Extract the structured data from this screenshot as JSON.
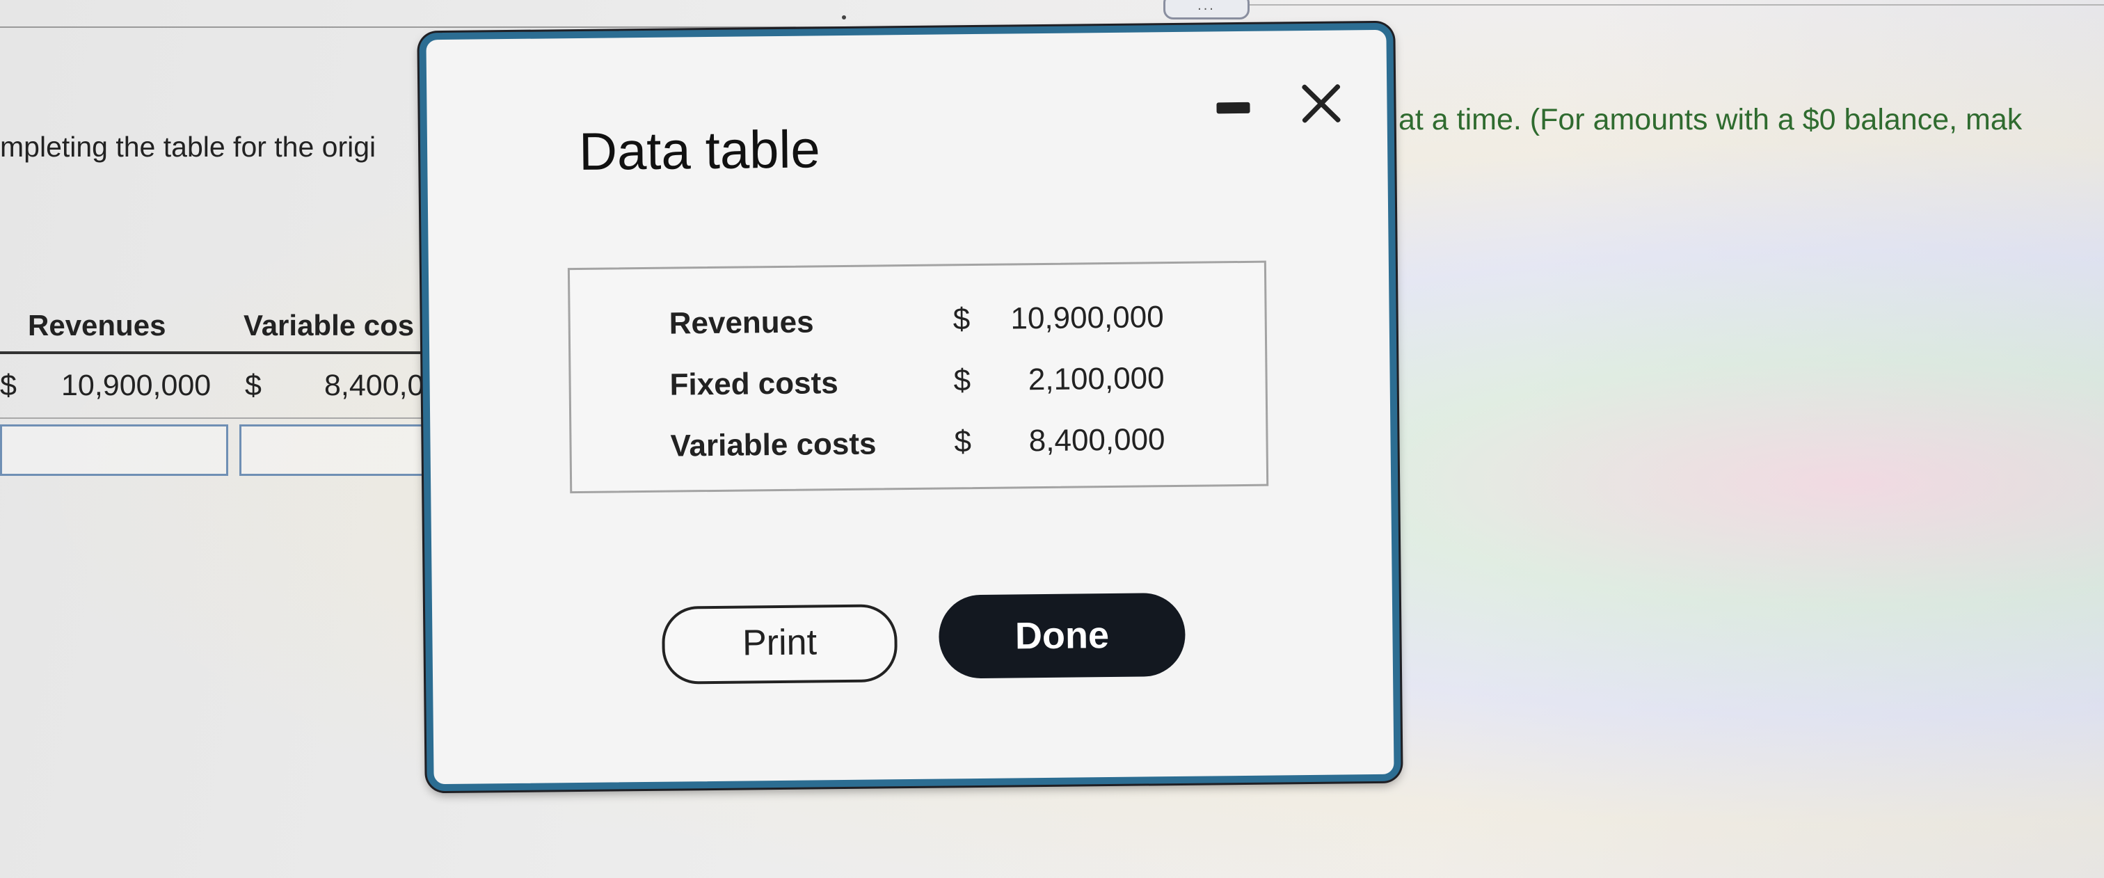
{
  "background": {
    "instruction_left": "mpleting the table for the origi",
    "instruction_right": "at a time. (For amounts with a $0 balance, mak",
    "table": {
      "headers": [
        "Revenues",
        "Variable cos"
      ],
      "row": {
        "revenue_currency": "$",
        "revenue_value": "10,900,000",
        "variable_currency": "$",
        "variable_value": "8,400,0"
      }
    },
    "tab_indicator": "..."
  },
  "dialog": {
    "title": "Data table",
    "rows": [
      {
        "label": "Revenues",
        "currency": "$",
        "value": "10,900,000"
      },
      {
        "label": "Fixed costs",
        "currency": "$",
        "value": "2,100,000"
      },
      {
        "label": "Variable costs",
        "currency": "$",
        "value": "8,400,000"
      }
    ],
    "print_label": "Print",
    "done_label": "Done"
  },
  "colors": {
    "dialog_border": "#2c6d92",
    "done_button": "#131820",
    "instruction_green": "#2f6b2f"
  }
}
